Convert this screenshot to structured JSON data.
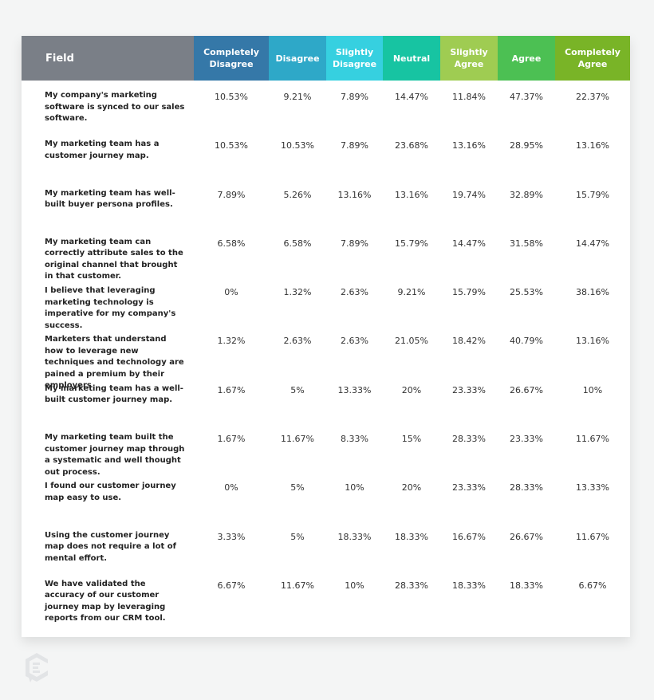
{
  "chart_data": {
    "type": "table",
    "title": "",
    "columns": [
      {
        "label": "Field",
        "color": "#7a7f87"
      },
      {
        "label": "Completely Disagree",
        "color": "#3578a8"
      },
      {
        "label": "Disagree",
        "color": "#2ea8c8"
      },
      {
        "label": "Slightly Disagree",
        "color": "#36d0e0"
      },
      {
        "label": "Neutral",
        "color": "#17c4a2"
      },
      {
        "label": "Slightly Agree",
        "color": "#9fcc52"
      },
      {
        "label": "Agree",
        "color": "#4cc053"
      },
      {
        "label": "Completely Agree",
        "color": "#79b427"
      }
    ],
    "rows": [
      {
        "field": "My company's marketing software is synced to our sales software.",
        "values": [
          "10.53%",
          "9.21%",
          "7.89%",
          "14.47%",
          "11.84%",
          "47.37%",
          "22.37%"
        ]
      },
      {
        "field": "My marketing team has a customer journey map.",
        "values": [
          "10.53%",
          "10.53%",
          "7.89%",
          "23.68%",
          "13.16%",
          "28.95%",
          "13.16%"
        ]
      },
      {
        "field": "My marketing team has well-built buyer persona profiles.",
        "values": [
          "7.89%",
          "5.26%",
          "13.16%",
          "13.16%",
          "19.74%",
          "32.89%",
          "15.79%"
        ]
      },
      {
        "field": "My marketing team can correctly attribute sales to the original channel that brought in that customer.",
        "values": [
          "6.58%",
          "6.58%",
          "7.89%",
          "15.79%",
          "14.47%",
          "31.58%",
          "14.47%"
        ]
      },
      {
        "field": "I believe that leveraging marketing technology is imperative for my company's success.",
        "values": [
          "0%",
          "1.32%",
          "2.63%",
          "9.21%",
          "15.79%",
          "25.53%",
          "38.16%"
        ]
      },
      {
        "field": "Marketers that understand how to leverage new techniques and technology are pained a premium by their employers",
        "values": [
          "1.32%",
          "2.63%",
          "2.63%",
          "21.05%",
          "18.42%",
          "40.79%",
          "13.16%"
        ]
      },
      {
        "field": "My marketing team has a well-built customer journey map.",
        "values": [
          "1.67%",
          "5%",
          "13.33%",
          "20%",
          "23.33%",
          "26.67%",
          "10%"
        ]
      },
      {
        "field": "My marketing team built the customer journey map through a systematic and well thought out process.",
        "values": [
          "1.67%",
          "11.67%",
          "8.33%",
          "15%",
          "28.33%",
          "23.33%",
          "11.67%"
        ]
      },
      {
        "field": "I found our customer journey map easy to use.",
        "values": [
          "0%",
          "5%",
          "10%",
          "20%",
          "23.33%",
          "28.33%",
          "13.33%"
        ]
      },
      {
        "field": "Using the customer journey map does not require a lot of mental effort.",
        "values": [
          "3.33%",
          "5%",
          "18.33%",
          "18.33%",
          "16.67%",
          "26.67%",
          "11.67%"
        ]
      },
      {
        "field": "We have validated the accuracy of our customer journey map by leveraging reports from our CRM tool.",
        "values": [
          "6.67%",
          "11.67%",
          "10%",
          "28.33%",
          "18.33%",
          "18.33%",
          "6.67%"
        ]
      }
    ]
  },
  "logo": {
    "icon": "brand-logo-icon"
  }
}
